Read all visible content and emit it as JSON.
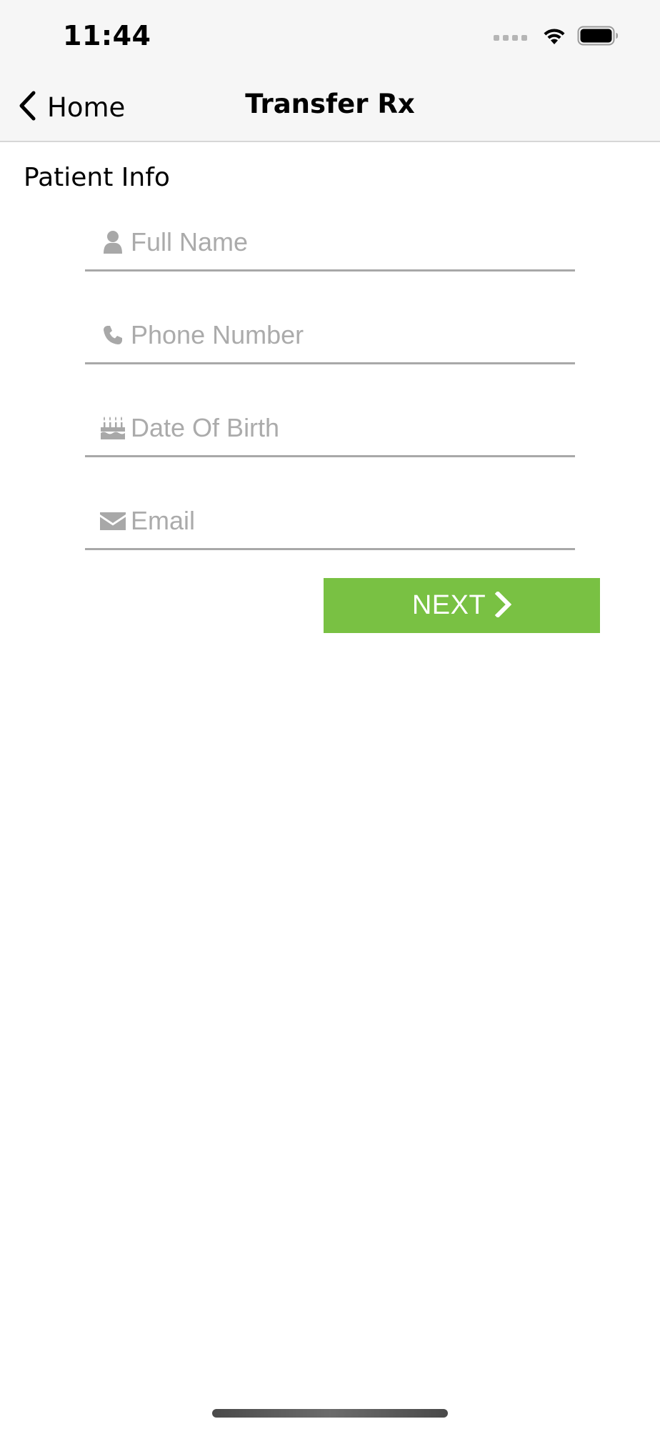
{
  "status_bar": {
    "time": "11:44",
    "icons": [
      "signal-icon",
      "wifi-icon",
      "battery-icon"
    ]
  },
  "nav": {
    "back_label": "Home",
    "back_icon": "chevron-left-icon",
    "title": "Transfer Rx"
  },
  "form": {
    "section_title": "Patient Info",
    "fields": [
      {
        "icon": "user-icon",
        "placeholder": "Full Name",
        "value": ""
      },
      {
        "icon": "phone-icon",
        "placeholder": "Phone Number",
        "value": ""
      },
      {
        "icon": "birthday-cake-icon",
        "placeholder": "Date Of Birth",
        "value": ""
      },
      {
        "icon": "envelope-icon",
        "placeholder": "Email",
        "value": ""
      }
    ],
    "next_label": "NEXT",
    "next_icon": "chevron-right-icon"
  },
  "colors": {
    "accent": "#79c143",
    "nav_background": "#f6f6f6",
    "placeholder": "#ababab",
    "icon": "#a8a8a8"
  }
}
